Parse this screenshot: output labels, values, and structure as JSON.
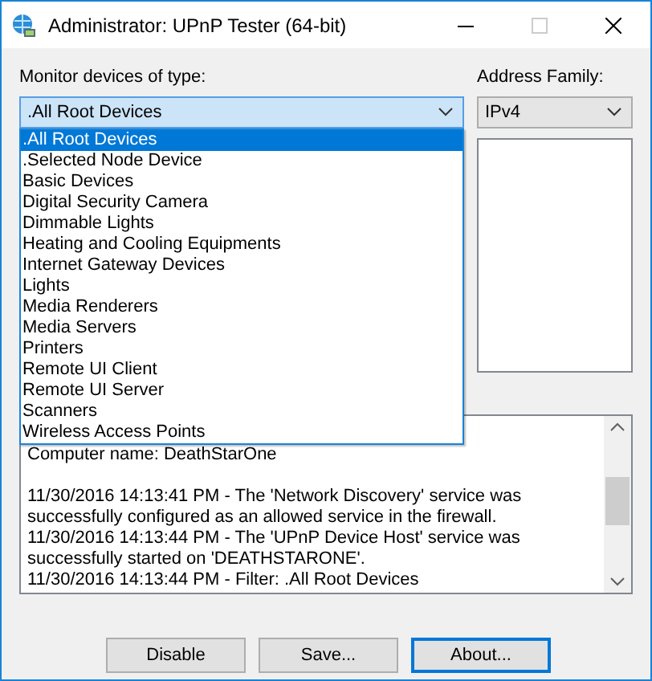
{
  "window": {
    "title": "Administrator: UPnP Tester (64-bit)"
  },
  "device_type": {
    "label": "Monitor devices of type:",
    "value": ".All Root Devices",
    "expanded": true,
    "options": [
      {
        "label": ".All Root Devices",
        "selected": true
      },
      {
        "label": ".Selected Node Device",
        "selected": false
      },
      {
        "label": "Basic Devices",
        "selected": false
      },
      {
        "label": "Digital Security Camera",
        "selected": false
      },
      {
        "label": "Dimmable Lights",
        "selected": false
      },
      {
        "label": "Heating and Cooling Equipments",
        "selected": false
      },
      {
        "label": "Internet Gateway Devices",
        "selected": false
      },
      {
        "label": "Lights",
        "selected": false
      },
      {
        "label": "Media Renderers",
        "selected": false
      },
      {
        "label": "Media Servers",
        "selected": false
      },
      {
        "label": "Printers",
        "selected": false
      },
      {
        "label": "Remote UI Client",
        "selected": false
      },
      {
        "label": "Remote UI Server",
        "selected": false
      },
      {
        "label": "Scanners",
        "selected": false
      },
      {
        "label": "Wireless Access Points",
        "selected": false
      }
    ]
  },
  "address_family": {
    "label": "Address Family:",
    "value": "IPv4"
  },
  "log": {
    "header": "Computer name: DeathStarOne",
    "entries": [
      "11/30/2016 14:13:41 PM - The 'Network Discovery' service was successfully configured as an allowed service in the firewall.",
      "11/30/2016 14:13:44 PM - The 'UPnP Device Host' service was successfully started on 'DEATHSTARONE'.",
      "11/30/2016 14:13:44 PM - Filter: .All Root Devices"
    ]
  },
  "buttons": [
    {
      "label": "Disable",
      "default": false
    },
    {
      "label": "Save...",
      "default": false
    },
    {
      "label": "About...",
      "default": true
    }
  ]
}
